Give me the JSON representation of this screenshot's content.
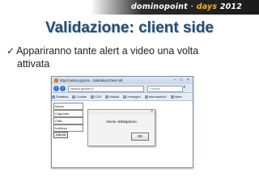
{
  "slide": {
    "brand_part1": "dominopoint",
    "brand_part2": "days",
    "brand_year": "2012",
    "title": "Validazione: client side",
    "bullet_line1": "Appariranno tante alert a video una volta",
    "bullet_line2": "attivata",
    "check_symbol": "✓"
  },
  "browser": {
    "tab_title": "http://cantoo.grydon...\\ValidationClient.nsf",
    "url": "cantoo.grydon.it",
    "search_placeholder": "rosaria",
    "toolbar_items": [
      "Disattiva",
      "Cookie",
      "CSS",
      "Moduli",
      "Immagini",
      "Informazioni",
      "Varie"
    ],
    "form_labels": [
      "Nome",
      "Cognome",
      "Citta'",
      "Indirizzo"
    ],
    "submit_label": "SALVA"
  },
  "alert": {
    "message": "Nome obbligatorio",
    "ok_label": "OK"
  },
  "colors": {
    "title": "#1f4e79",
    "brand_accent": "#f0b323"
  }
}
